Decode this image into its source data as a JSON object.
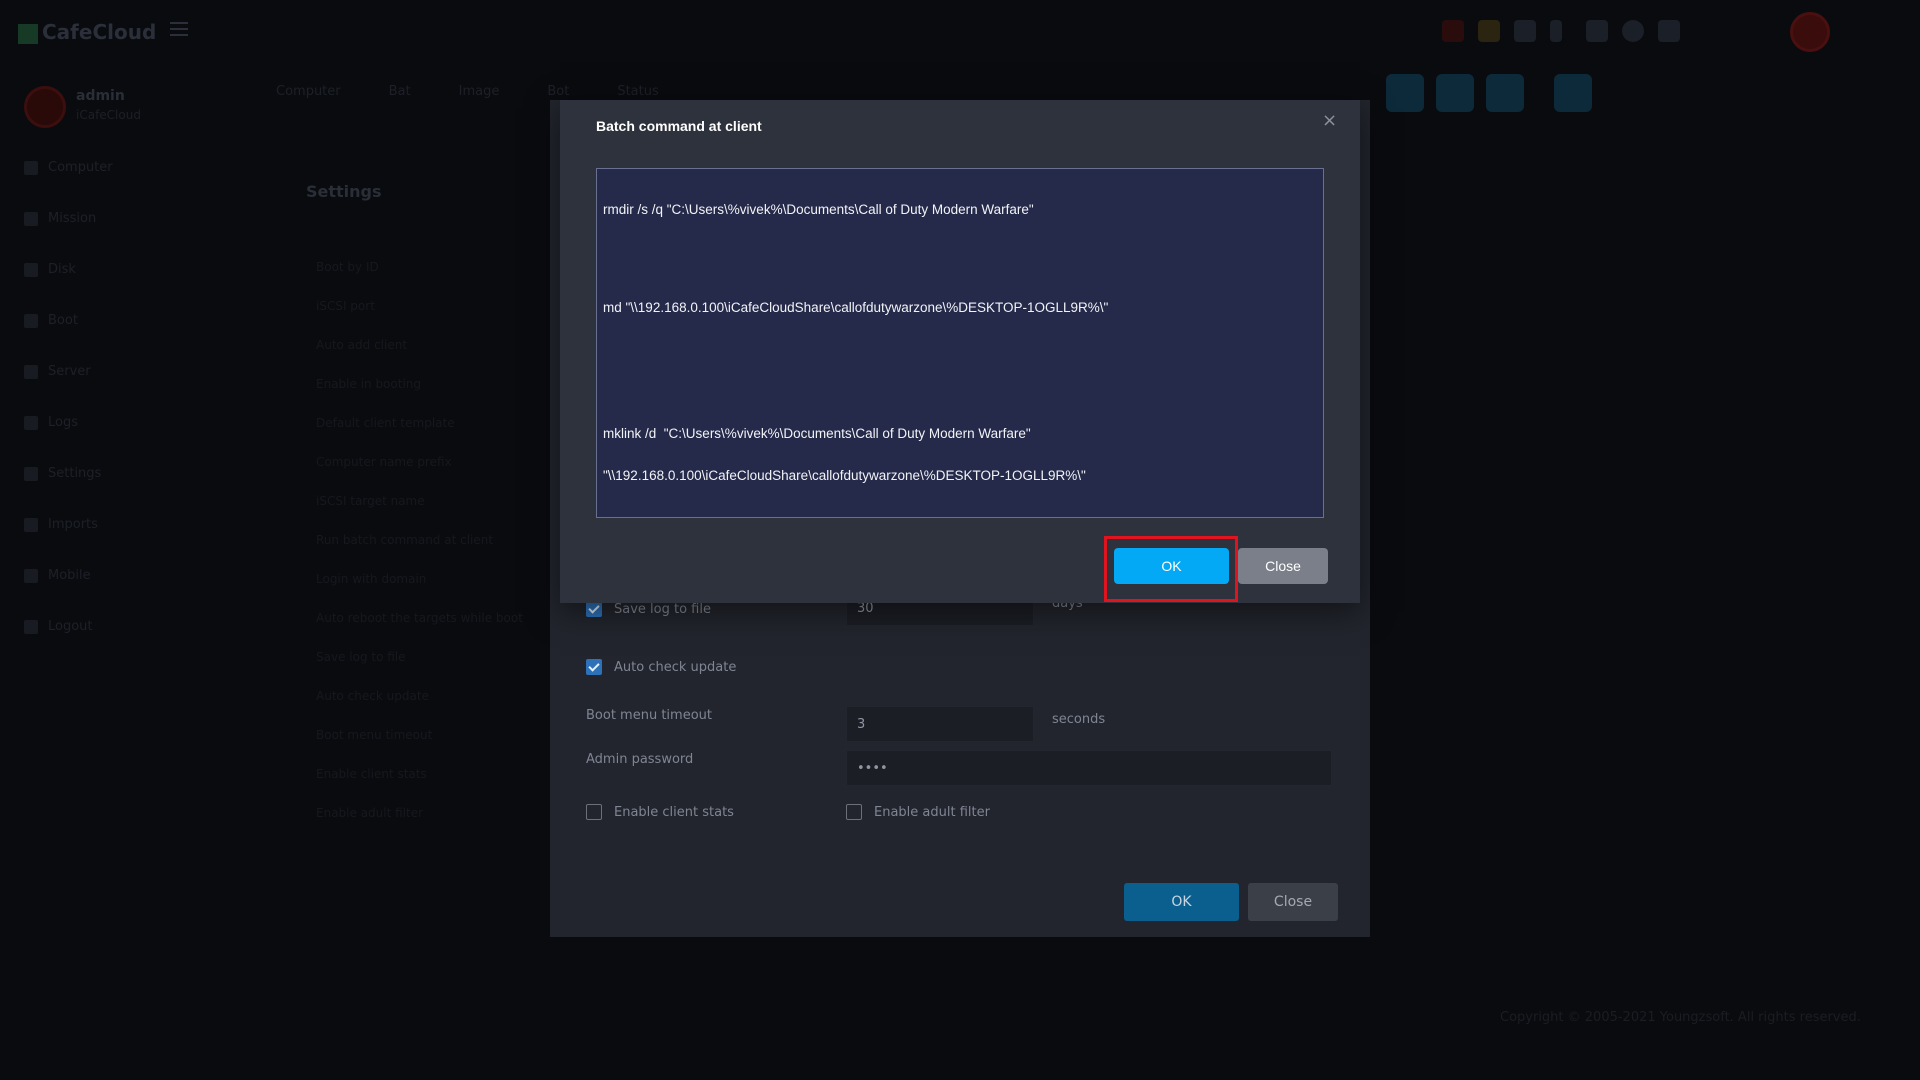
{
  "app": {
    "logo_text": "CafeCloud",
    "user": {
      "name": "admin",
      "subtitle": "iCafeCloud"
    },
    "tabs": [
      "Computer",
      "Bat",
      "Image",
      "Bot",
      "Status"
    ],
    "sidebar": [
      {
        "label": "Computer",
        "icon": "monitor-icon"
      },
      {
        "label": "Mission",
        "icon": "flag-icon"
      },
      {
        "label": "Disk",
        "icon": "disk-icon"
      },
      {
        "label": "Boot",
        "icon": "grid-icon"
      },
      {
        "label": "Server",
        "icon": "server-icon"
      },
      {
        "label": "Logs",
        "icon": "log-icon"
      },
      {
        "label": "Settings",
        "icon": "gear-icon"
      },
      {
        "label": "Imports",
        "icon": "import-icon"
      },
      {
        "label": "Mobile",
        "icon": "pencil-icon"
      },
      {
        "label": "Logout",
        "icon": "logout-icon"
      }
    ],
    "settings_title": "Settings",
    "settings_list": [
      "Boot by ID",
      "iSCSI port",
      "Auto add client",
      "Enable in booting",
      "Default client template",
      "Computer name prefix",
      "iSCSI target name",
      "Run batch command at client",
      "Login with domain",
      "Auto reboot the targets while boot",
      "Save log to file",
      "Auto check update",
      "Boot menu timeout",
      "Enable client stats",
      "Enable adult filter"
    ],
    "footer": "Copyright © 2005-2021 Youngzsoft. All rights reserved."
  },
  "settings_dialog": {
    "save_log": {
      "label": "Save log to file",
      "checked": true,
      "value": "30",
      "unit": "days"
    },
    "auto_update": {
      "label": "Auto check update",
      "checked": true
    },
    "boot_timeout": {
      "label": "Boot menu timeout",
      "value": "3",
      "unit": "seconds"
    },
    "admin_password": {
      "label": "Admin password",
      "value": "••••"
    },
    "client_stats": {
      "label": "Enable client stats",
      "checked": false
    },
    "adult_filter": {
      "label": "Enable adult filter",
      "checked": false
    },
    "ok_label": "OK",
    "close_label": "Close"
  },
  "batch_modal": {
    "title": "Batch command at client",
    "lines": [
      "rmdir /s /q \"C:\\Users\\%vivek%\\Documents\\Call of Duty Modern Warfare\"",
      "",
      "md \"\\\\192.168.0.100\\iCafeCloudShare\\callofdutywarzone\\%DESKTOP-1OGLL9R%\\\"",
      "",
      "",
      "mklink /d  \"C:\\Users\\%vivek%\\Documents\\Call of Duty Modern Warfare\"",
      "\"\\\\192.168.0.100\\iCafeCloudShare\\callofdutywarzone\\%DESKTOP-1OGLL9R%\\\""
    ],
    "ok_label": "OK",
    "close_label": "Close",
    "close_x": "×"
  },
  "colors": {
    "ok_blue": "#03a9f4",
    "close_gray": "#7a7f8a",
    "highlight_red": "#e0141e"
  }
}
